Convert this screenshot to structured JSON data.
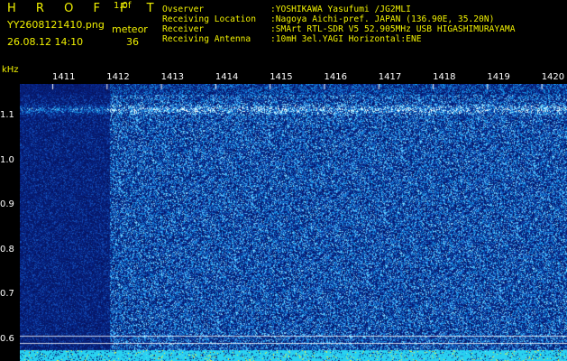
{
  "header": {
    "app_title": "H R O F F T",
    "version": "1.0f",
    "filename": "YY2608121410.png",
    "datetime": "26.08.12 14:10",
    "meteor_label": "meteor",
    "meteor_count": "36"
  },
  "station": {
    "observer_label": "Ovserver",
    "observer_value": ":YOSHIKAWA Yasufumi /JG2MLI",
    "location_label": "Receiving Location",
    "location_value": ":Nagoya Aichi-pref. JAPAN (136.90E, 35.20N)",
    "receiver_label": "Receiver",
    "receiver_value": ":SMArt RTL-SDR V5 52.905MHz USB HIGASHIMURAYAMA",
    "antenna_label": "Receiving Antenna",
    "antenna_value": ":10mH 3el.YAGI Horizontal:ENE"
  },
  "spectrogram": {
    "freq_unit": "kHz",
    "freq_ticks": [
      "1.1",
      "1.0",
      "0.9",
      "0.8",
      "0.7",
      "0.6"
    ],
    "time_ticks": [
      "1411",
      "1412",
      "1413",
      "1414",
      "1415",
      "1416",
      "1417",
      "1418",
      "1419",
      "1420"
    ],
    "colors": {
      "background": "#000000",
      "label": "#f0f000",
      "tick_label": "#ffffff",
      "noise_low": "#0a1a8c",
      "noise_high": "#4aa8ff",
      "baseline": "#33e0ff"
    }
  }
}
